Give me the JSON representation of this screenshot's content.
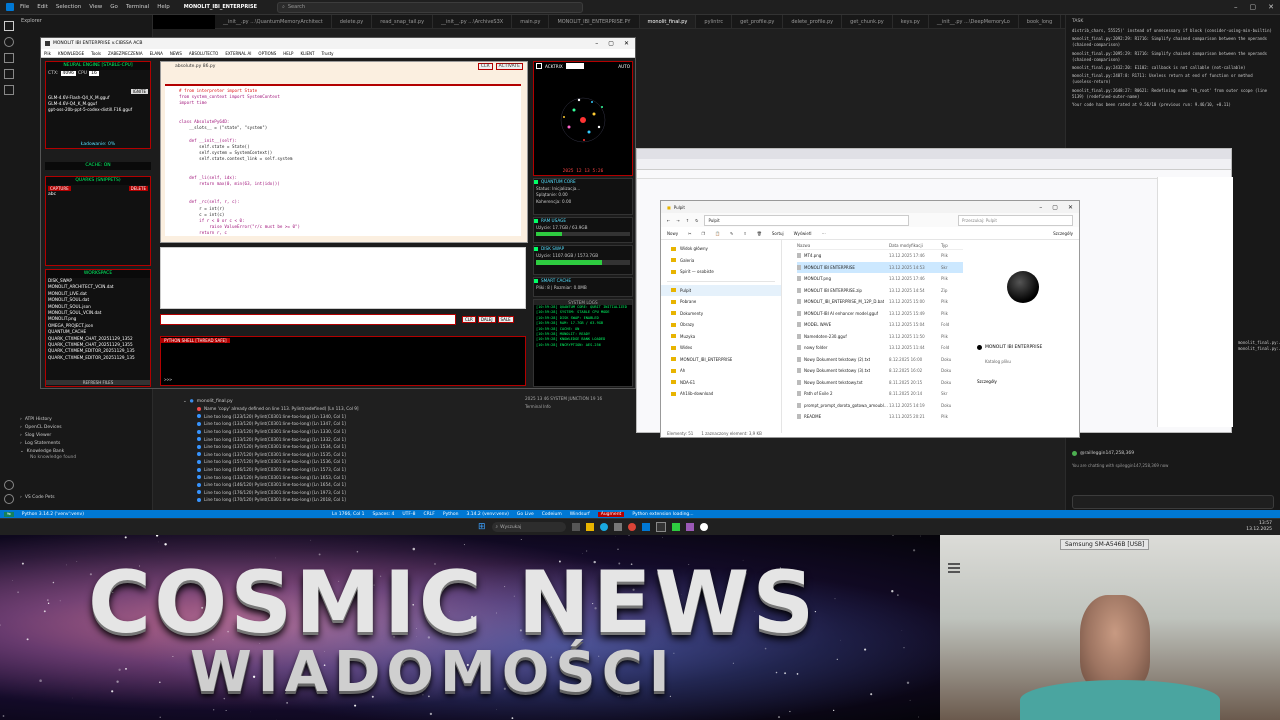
{
  "vscode": {
    "menu": [
      "File",
      "Edit",
      "Selection",
      "View",
      "Go",
      "Terminal",
      "Help"
    ],
    "window_title": "MONOLIT_IBI_ENTERPRISE",
    "search_placeholder": "Search",
    "explorer_label": "Explorer",
    "tabs": [
      "__init__.py ...\\QuantumMemoryArchitect",
      "delete.py",
      "read_snap_tail.py",
      "__init__.py ...\\ArchiveS3X",
      "main.py",
      "MONOLIT_IBI_ENTERPRISE.PY",
      "monolit_final.py",
      "pylintrc",
      "get_profile.py",
      "delete_profile.py",
      "get_chunk.py",
      "keys.py",
      "__init__.py ...\\DeepMemoryLo",
      "book_long"
    ],
    "active_tab_index": 6,
    "sidebar_bottom": [
      "ATPI History",
      "OpenCL Devices",
      "Slog Viewer",
      "Log Statements",
      "Knowledge Bank",
      "No knowledge found",
      "VS Code Pets"
    ],
    "problems_file": "monolit_final.py",
    "problems": [
      "Name 'copy' already defined on line 113. Pylint(redefined) [Ln 113, Col 9]",
      "Line too long (123/120) Pylint(C0301:line-too-long) [Ln 1340, Col 1]",
      "Line too long (133/120) Pylint(C0301:line-too-long) [Ln 1347, Col 1]",
      "Line too long (133/120) Pylint(C0301:line-too-long) [Ln 1330, Col 1]",
      "Line too long (133/120) Pylint(C0301:line-too-long) [Ln 1332, Col 1]",
      "Line too long (137/120) Pylint(C0301:line-too-long) [Ln 1534, Col 1]",
      "Line too long (137/120) Pylint(C0301:line-too-long) [Ln 1535, Col 1]",
      "Line too long (157/120) Pylint(C0301:line-too-long) [Ln 1536, Col 1]",
      "Line too long (146/120) Pylint(C0301:line-too-long) [Ln 1573, Col 1]",
      "Line too long (133/120) Pylint(C0301:line-too-long) [Ln 1653, Col 1]",
      "Line too long (146/120) Pylint(C0301:line-too-long) [Ln 1654, Col 1]",
      "Line too long (176/120) Pylint(C0301:line-too-long) [Ln 1973, Col 1]",
      "Line too long (170/120) Pylint(C0301:line-too-long) [Ln 2018, Col 1]"
    ],
    "right_panel_title": "TASK",
    "right_panel_lines": [
      "distrib_chars, 55525)' instead of unnecessary if block (consider-using-min-builtin)",
      "monolit_final.py:2092:29: R1716: Simplify chained comparison between the operands (chained-comparison)",
      "monolit_final.py:2095:29: R1716: Simplify chained comparison between the operands (chained-comparison)",
      "monolit_final.py:2432:20: E1102: callback is not callable (not-callable)",
      "monolit_final.py:2487:8: R1711: Useless return at end of function or method (useless-return)",
      "monolit_final.py:2648:27: R0621: Redefining name 'tk_root' from outer scope (line 5139) (redefined-outer-name)",
      "Your code has been rated at 9.56/10 (previous run: 9.46/10, +0.11)"
    ],
    "right_panel_lines2": [
      "monolit_final.py:4053:8: C0301: Line too long (334/120) (line-too-long)",
      "monolit_final.py:4084:8: C0301: Line too long (342/120) (line-too-long)"
    ],
    "chat_user": "@railleggin147,258,369",
    "chat_note": "You are chatting with spileggin147,258,369 now",
    "status_items": [
      "Ln 1766, Col 1",
      "Spaces: 4",
      "UTF-8",
      "CRLF",
      "Python",
      "3.14.2 (venv:venv)",
      "Go Live",
      "Codeium",
      "Windsurf",
      "Augment"
    ],
    "status_left": "Python 3.14.2 ('venv':venv)",
    "status_mid": "Python extension loading..."
  },
  "monolit": {
    "title": "MONOLIT IBI ENTERPRISE v.CIBSSA ACB",
    "menu": [
      "Plik",
      "KNOWLEDGE",
      "Tools",
      "ZABEZPIECZENIA",
      "ELANA",
      "NEWS",
      "ABSOLUTECTO",
      "EXTERNAL AI",
      "OPTIONS",
      "HELP",
      "KLIENT",
      "Trusty"
    ],
    "neural_engine_title": "NEURAL ENGINE [STABLE-CPU]",
    "ctx_label": "CTX:",
    "ctx_value": "4096",
    "cpu_label": "CPU",
    "cpu_value": "16",
    "ignite_label": "IGNITE",
    "models": [
      "GLM-4.6V-Flash-Q4_K_M.gguf",
      "GLM-4.6V-Q4_K_M.gguf",
      "gpt-oss-20b-ppt-5-codex-distill.F16.gguf"
    ],
    "ladowanie": "Ładowanie: 0%",
    "cache_label": "CACHE: ON",
    "quarks_title": "QUARKS (SNIPPETS)",
    "capture_label": "CAPTURE",
    "delete_label": "DELETE",
    "quark_item": "abc",
    "workspace_title": "WORKSPACE",
    "workspace_files": [
      "DISK_SWAP",
      "MONOLIT_ARCHITECT_VCIN.dat",
      "MONOLIT_LIVE.dat",
      "MONOLIT_SOUL.dat",
      "MONOLIT_SOUL.json",
      "MONOLIT_SOUL_VCIN.dat",
      "MONOLIT.png",
      "OMEGA_PROJECT.json",
      "QUANTUM_CACHE",
      "QUARK_CTXMEM_CHAT_20251129_1352",
      "QUARK_CTXMEM_CHAT_20251129_1355",
      "QUARK_CTXMEM_EDITOR_20251129_135",
      "QUARK_CTXMEM_EDITOR_20251129_135"
    ],
    "refresh_label": "REFRESH FILES",
    "editor_file": "absolute.py 86.py",
    "editor_btn1": "CLR",
    "editor_btn2": "ACTIVATE",
    "code_lines": [
      "# from interpreter import State",
      "from system_context import SystemContext",
      "import time",
      "",
      "",
      "class AbsolutePy64D:",
      "    __slots__ = (\"state\", \"system\")",
      "",
      "    def __init__(self):",
      "        self.state = State()",
      "        self.system = SystemContext()",
      "        self.state.context_link = self.system",
      "",
      "",
      "    def _li(self, idx):",
      "        return max(0, min(63, int(idx)))",
      "",
      "",
      "    def _rc(self, r, c):",
      "        r = int(r)",
      "        c = int(c)",
      "        if r < 0 or c < 0:",
      "            raise ValueError(\"r/c must be >= 0\")",
      "        return r, c"
    ],
    "send_btn1": "CLR",
    "send_btn2": "DALEJ",
    "send_btn3": "SALE",
    "shell_title": "PYTHON SHELL [THREAD SAFE]",
    "shell_prompt": ">>>",
    "acktrix_label": "ACKTRIX",
    "auto_label": "AUTO",
    "clock": "2025 12 13 5:26",
    "quantum_core_title": "QUANTUM CORE",
    "status_label": "Status: Inicjalizacja...",
    "splatanie": "Splątanie: 0.00",
    "koherencja": "Koherencja: 0.00",
    "ram_title": "RAM USAGE",
    "ram_value": "Użycie: 17.7GB / 63.9GB",
    "ram_fill": 0.28,
    "disk_title": "DISK SWAP",
    "disk_value": "Użycie: 1107.0GB / 1573.7GB",
    "disk_fill": 0.7,
    "smart_title": "SMART CACHE",
    "smart_value": "Pliki: 8 | Rozmiar: 0.0MB",
    "logs_title": "SYSTEM LOGS",
    "log_lines": [
      "[10:59:28] QUANTUM CORE: QUBIT INITIALIZED",
      "[10:59:28] SYSTEM: STABLE CPU MODE",
      "[10:59:28] DISK SWAP: ENABLED",
      "[10:59:28] RAM: 17.7GB / 63.9GB",
      "[10:59:28] CACHE: ON",
      "[10:59:28] MONOLIT: READY",
      "[10:59:28] KNOWLEDGE BANK LOADED",
      "[10:59:28] ENCRYPTION: AES-256"
    ],
    "bottom_ticker": "2025 13 46 SYSTEM JUNCTION 19 16",
    "terminal_tab": "Terminal Info"
  },
  "explorer": {
    "title": "Pulpit",
    "path": "Pulpit",
    "search_placeholder": "Przeszukaj: Pulpit",
    "toolbar": [
      "Nowy",
      "Sortuj",
      "Wyświetl"
    ],
    "details_btn": "Szczegóły",
    "nav_items": [
      "Widok główny",
      "Galeria",
      "Spirit — osobiste",
      "",
      "Pulpit",
      "Pobrane",
      "Dokumenty",
      "Obrazy",
      "Muzyka",
      "Wideo",
      "MONOLIT_IBI_ENTERPRISE",
      "Ah",
      "NDA-E1",
      "Ah1lib-download"
    ],
    "col_name": "Nazwa",
    "col_date": "Data modyfikacji",
    "col_type": "Typ",
    "files": [
      {
        "name": "MT4.png",
        "date": "13.12.2025 17:46",
        "type": "Plik"
      },
      {
        "name": "MONOLIT IBI ENTERPRISE",
        "date": "13.12.2025 14:53",
        "type": "Skr"
      },
      {
        "name": "MONOLIT.png",
        "date": "13.12.2025 17:46",
        "type": "Plik"
      },
      {
        "name": "MONOLIT IBI ENTERPRISE.zip",
        "date": "13.12.2025 14:54",
        "type": "Zip"
      },
      {
        "name": "MONOLIT_IBI_ENTERPRISE_M_12P_D.bat",
        "date": "13.12.2025 15:00",
        "type": "Plik"
      },
      {
        "name": "MONOLIT-IBI AI enhancer model.gguf",
        "date": "13.12.2025 15:49",
        "type": "Plik"
      },
      {
        "name": "MODEL WAVE",
        "date": "13.12.2025 15:04",
        "type": "Fold"
      },
      {
        "name": "Namedoten-230.gguf",
        "date": "13.12.2025 11:50",
        "type": "Plik"
      },
      {
        "name": "nowy folder",
        "date": "13.12.2025 11:44",
        "type": "Fold"
      },
      {
        "name": "Nowy Dokument tekstowy (2).txt",
        "date": "8.12.2025 16:00",
        "type": "Doku"
      },
      {
        "name": "Nowy Dokument tekstowy (3).txt",
        "date": "8.12.2025 16:02",
        "type": "Doku"
      },
      {
        "name": "Nowy Dokument tekstowy.txt",
        "date": "8.11.2025 20:15",
        "type": "Doku"
      },
      {
        "name": "Path of Exile 2",
        "date": "8.11.2025 20:14",
        "type": "Skr"
      },
      {
        "name": "prompt_prompt_dorota_gotowa_amoubla.txt",
        "date": "13.12.2025 14:19",
        "type": "Doku"
      },
      {
        "name": "README",
        "date": "13.11.2025 20:21",
        "type": "Plik"
      }
    ],
    "preview_title": "MONOLIT IBI ENTERPRISE",
    "preview_sub": "Katalog pliku",
    "preview_details": "Szczegóły",
    "status_left": "Elementy: 51",
    "status_mid": "1 zaznaczony element: 3,9 KB"
  },
  "taskbar": {
    "search_placeholder": "Wyszukaj",
    "time": "13:57",
    "date": "13.12.2025"
  },
  "banner": {
    "title": "COSMIC NEWS",
    "subtitle": "WIADOMOŚCI"
  },
  "webcam": {
    "device_label": "Samsung SM-A546B [USB]"
  },
  "colors": {
    "vscode_blue": "#0078d4",
    "neon_green": "#00ff66",
    "alert_red": "#b30000"
  }
}
